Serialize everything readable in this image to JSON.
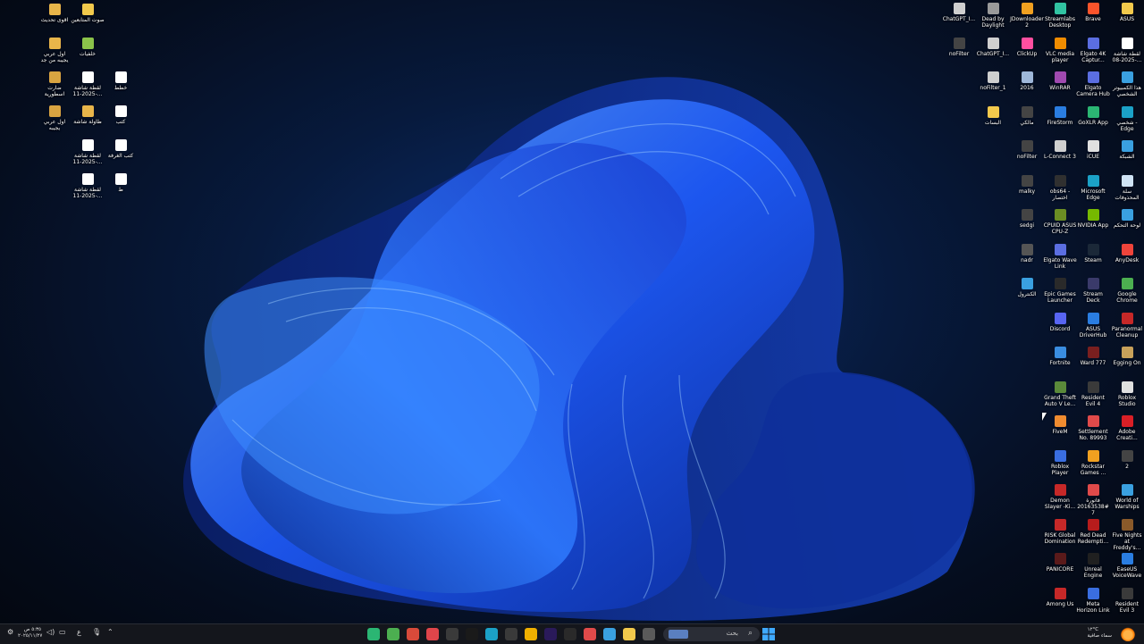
{
  "colors": {
    "accent": "#1e6bff",
    "taskbar": "#14161c"
  },
  "left_icons": [
    {
      "label": "اقوى تحديث",
      "icon": "folder-icon",
      "color": "#e8b54a"
    },
    {
      "label": "صوت المتابعين",
      "icon": "folder-icon",
      "color": "#f2c94c"
    },
    {
      "label": "اول عربي يجيبه من جد",
      "icon": "folder-icon",
      "color": "#e8b54a"
    },
    {
      "label": "خلفيات",
      "icon": "folder-icon",
      "color": "#8bc34a"
    },
    {
      "label": "ضارت اسطورية",
      "icon": "folder-icon",
      "color": "#d9a441"
    },
    {
      "label": "لقطة شاشة 2025-11-...",
      "icon": "image-icon",
      "color": "#ffffff"
    },
    {
      "label": "خطط",
      "icon": "document-icon",
      "color": "#ffffff"
    },
    {
      "label": "اول عربي يجيبه",
      "icon": "folder-icon",
      "color": "#d9a441"
    },
    {
      "label": "طاولة شاشة",
      "icon": "folder-icon",
      "color": "#e8b54a"
    },
    {
      "label": "كتب",
      "icon": "document-icon",
      "color": "#ffffff"
    },
    {
      "label": "لقطة شاشة 2025-11-...",
      "icon": "image-icon",
      "color": "#ffffff"
    },
    {
      "label": "كتب الغرفة",
      "icon": "document-icon",
      "color": "#ffffff"
    },
    {
      "label": "لقطة شاشة 2025-11-...",
      "icon": "image-icon",
      "color": "#ffffff"
    },
    {
      "label": "ط",
      "icon": "document-icon",
      "color": "#ffffff"
    }
  ],
  "right_icons": [
    {
      "label": "ChatGPT_I...",
      "icon": "app-icon",
      "color": "#cfcfcf"
    },
    {
      "label": "Dead by Daylight",
      "icon": "game-icon",
      "color": "#9a9a9a"
    },
    {
      "label": "JDownloader 2",
      "icon": "download-icon",
      "color": "#f0a020"
    },
    {
      "label": "Streamlabs Desktop",
      "icon": "stream-icon",
      "color": "#31c3a2"
    },
    {
      "label": "Brave",
      "icon": "brave-icon",
      "color": "#fb542b"
    },
    {
      "label": "ASUS",
      "icon": "folder-icon",
      "color": "#f2c94c"
    },
    {
      "label": "noFilter",
      "icon": "app-icon",
      "color": "#444444"
    },
    {
      "label": "ChatGPT_I...",
      "icon": "app-icon",
      "color": "#cfcfcf"
    },
    {
      "label": "ClickUp",
      "icon": "clickup-icon",
      "color": "#ff4fa0"
    },
    {
      "label": "VLC media player",
      "icon": "vlc-icon",
      "color": "#f08c00"
    },
    {
      "label": "Elgato 4K Captur...",
      "icon": "capture-icon",
      "color": "#5b6ee1"
    },
    {
      "label": "لقطة شاشة 2025-08-...",
      "icon": "image-icon",
      "color": "#ffffff"
    },
    {
      "label": "noFilter_1",
      "icon": "app-icon",
      "color": "#cfcfcf"
    },
    {
      "label": "2016",
      "icon": "app-icon",
      "color": "#9fb7d9"
    },
    {
      "label": "WinRAR",
      "icon": "archive-icon",
      "color": "#a04ab0"
    },
    {
      "label": "Elgato Camera Hub",
      "icon": "camera-icon",
      "color": "#5b6ee1"
    },
    {
      "label": "هذا الكمبيوتر الشخصي",
      "icon": "computer-icon",
      "color": "#3aa0e0"
    },
    {
      "label": "البسات",
      "icon": "folder-icon",
      "color": "#f2c94c"
    },
    {
      "label": "مالكي",
      "icon": "app-icon",
      "color": "#444444"
    },
    {
      "label": "FireStorm",
      "icon": "firestorm-icon",
      "color": "#2a7de1"
    },
    {
      "label": "GoXLR App",
      "icon": "audio-icon",
      "color": "#2bb673"
    },
    {
      "label": "شخصي - Edge",
      "icon": "edge-icon",
      "color": "#1ba1c7"
    },
    {
      "label": "noFilter",
      "icon": "app-icon",
      "color": "#444444"
    },
    {
      "label": "L-Connect 3",
      "icon": "fan-icon",
      "color": "#d0d0d0"
    },
    {
      "label": "iCUE",
      "icon": "icue-icon",
      "color": "#e0e0e0"
    },
    {
      "label": "الشبكة",
      "icon": "network-icon",
      "color": "#3aa0e0"
    },
    {
      "label": "malky",
      "icon": "app-icon",
      "color": "#444444"
    },
    {
      "label": "obs64 - اختصار",
      "icon": "obs-icon",
      "color": "#303030"
    },
    {
      "label": "Microsoft Edge",
      "icon": "edge-icon",
      "color": "#1ba1c7"
    },
    {
      "label": "سلة المحذوفات",
      "icon": "recycle-bin-icon",
      "color": "#cfe3f5"
    },
    {
      "label": "sedgi",
      "icon": "app-icon",
      "color": "#444444"
    },
    {
      "label": "CPUID ASUS CPU-Z",
      "icon": "cpu-icon",
      "color": "#6b8e23"
    },
    {
      "label": "NVIDIA App",
      "icon": "nvidia-icon",
      "color": "#76b900"
    },
    {
      "label": "لوحة التحكم",
      "icon": "control-panel-icon",
      "color": "#3aa0e0"
    },
    {
      "label": "nadr",
      "icon": "app-icon",
      "color": "#555555"
    },
    {
      "label": "Elgato Wave Link",
      "icon": "wave-icon",
      "color": "#5b6ee1"
    },
    {
      "label": "Steam",
      "icon": "steam-icon",
      "color": "#1b2838"
    },
    {
      "label": "AnyDesk",
      "icon": "anydesk-icon",
      "color": "#ef443b"
    },
    {
      "label": "الكنترول",
      "icon": "app-icon",
      "color": "#3aa0e0"
    },
    {
      "label": "Epic Games Launcher",
      "icon": "epic-icon",
      "color": "#2a2a2a"
    },
    {
      "label": "Stream Deck",
      "icon": "streamdeck-icon",
      "color": "#3a3a6a"
    },
    {
      "label": "Google Chrome",
      "icon": "chrome-icon",
      "color": "#4caf50"
    },
    {
      "label": "Discord",
      "icon": "discord-icon",
      "color": "#5865f2"
    },
    {
      "label": "ASUS DriverHub",
      "icon": "asus-icon",
      "color": "#2a7de1"
    },
    {
      "label": "Paranormal Cleanup",
      "icon": "game-icon",
      "color": "#c62828"
    },
    {
      "label": "Fortnite",
      "icon": "fortnite-icon",
      "color": "#3a8de0"
    },
    {
      "label": "Ward 777",
      "icon": "game-icon",
      "color": "#7a1f1f"
    },
    {
      "label": "Egging On",
      "icon": "game-icon",
      "color": "#c8a15a"
    },
    {
      "label": "Grand Theft Auto V Le...",
      "icon": "gta-icon",
      "color": "#5a8a3a"
    },
    {
      "label": "Resident Evil 4",
      "icon": "game-icon",
      "color": "#3a3a3a"
    },
    {
      "label": "Roblox Studio",
      "icon": "roblox-icon",
      "color": "#e0e0e0"
    },
    {
      "label": "FiveM",
      "icon": "fivem-icon",
      "color": "#f08c30"
    },
    {
      "label": "Settlement No. 89993",
      "icon": "game-icon",
      "color": "#e04a4a"
    },
    {
      "label": "Adobe Creati...",
      "icon": "adobe-icon",
      "color": "#da1f26"
    },
    {
      "label": "Roblox Player",
      "icon": "roblox-icon",
      "color": "#3a6ee0"
    },
    {
      "label": "Rockstar Games ...",
      "icon": "rockstar-icon",
      "color": "#f0a020"
    },
    {
      "label": "2",
      "icon": "app-icon",
      "color": "#444444"
    },
    {
      "label": "Demon Slayer -Ki...",
      "icon": "game-icon",
      "color": "#c62828"
    },
    {
      "label": "فاتورة #201635387",
      "icon": "pdf-icon",
      "color": "#e04a4a"
    },
    {
      "label": "World of Warships",
      "icon": "game-icon",
      "color": "#3aa0e0"
    },
    {
      "label": "RISK Global Domination",
      "icon": "game-icon",
      "color": "#c62828"
    },
    {
      "label": "Red Dead Redempti...",
      "icon": "game-icon",
      "color": "#b71c1c"
    },
    {
      "label": "Five Nights at Freddy's...",
      "icon": "game-icon",
      "color": "#8a5a2a"
    },
    {
      "label": "PANICORE",
      "icon": "game-icon",
      "color": "#5a1a1a"
    },
    {
      "label": "Unreal Engine",
      "icon": "unreal-icon",
      "color": "#202020"
    },
    {
      "label": "EaseUS VoiceWave",
      "icon": "voice-icon",
      "color": "#2a7de1"
    },
    {
      "label": "Among Us",
      "icon": "amongus-icon",
      "color": "#c62828"
    },
    {
      "label": "Meta Horizon Link",
      "icon": "meta-icon",
      "color": "#3a6ee0"
    },
    {
      "label": "Resident Evil 3",
      "icon": "game-icon",
      "color": "#3a3a3a"
    }
  ],
  "taskbar": {
    "search_placeholder": "بحث",
    "apps": [
      {
        "icon": "app-green-icon",
        "color": "#2bb673"
      },
      {
        "icon": "chrome-icon",
        "color": "#4caf50"
      },
      {
        "icon": "chrome-red-icon",
        "color": "#d84a3a"
      },
      {
        "icon": "chrome-red-icon",
        "color": "#e0454a"
      },
      {
        "icon": "close-icon",
        "color": "#3a3a3a"
      },
      {
        "icon": "capcut-icon",
        "color": "#1a1a1a"
      },
      {
        "icon": "edge-icon",
        "color": "#1ba1c7"
      },
      {
        "icon": "settings-icon",
        "color": "#3a3a3a"
      },
      {
        "icon": "chrome-icon",
        "color": "#f0b000"
      },
      {
        "icon": "premiere-icon",
        "color": "#2a1a5a"
      },
      {
        "icon": "calendar-icon",
        "color": "#2a2a2a"
      },
      {
        "icon": "app-red-icon",
        "color": "#e04a4a"
      },
      {
        "icon": "photos-icon",
        "color": "#3aa0e0"
      },
      {
        "icon": "file-explorer-icon",
        "color": "#f2c94c"
      },
      {
        "icon": "snip-icon",
        "color": "#5a5a5a"
      }
    ],
    "clock_time": "٥:٣٥ ص",
    "clock_date": "٢٠٢٥/١١/٢٧",
    "language": "ع",
    "weather_temp": "١٢°C",
    "weather_text": "سماء صافية"
  }
}
